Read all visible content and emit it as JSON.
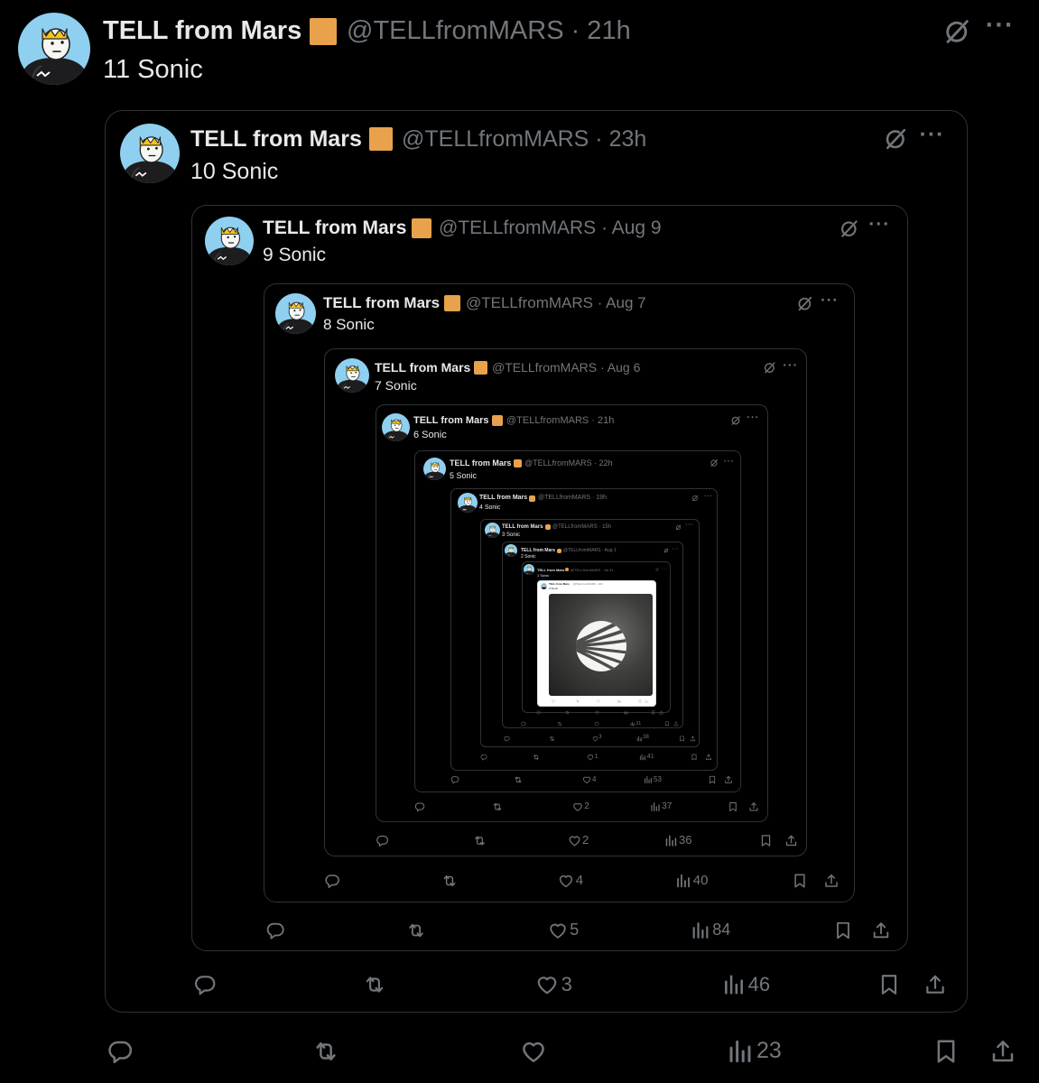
{
  "author_name": "TELL from Mars",
  "author_handle": "@TELLfromMARS",
  "colors": {
    "background": "#000000",
    "text": "#e7e9ea",
    "muted": "#71767b",
    "border": "#2f3336",
    "badge": "#e8a24c",
    "avatar_bg": "#8fd0f0"
  },
  "icons": [
    "avatar-icon",
    "badge-icon",
    "grok-icon",
    "more-icon",
    "reply-icon",
    "retweet-icon",
    "like-icon",
    "views-icon",
    "bookmark-icon",
    "share-icon"
  ],
  "posts": [
    {
      "time": "· 21h",
      "text": "11 Sonic",
      "likes": "",
      "views": "23"
    },
    {
      "time": "· 23h",
      "text": "10 Sonic",
      "likes": "3",
      "views": "46"
    },
    {
      "time": "· Aug 9",
      "text": "9 Sonic",
      "likes": "5",
      "views": "84"
    },
    {
      "time": "· Aug 7",
      "text": "8 Sonic",
      "likes": "4",
      "views": "40"
    },
    {
      "time": "· Aug 6",
      "text": "7 Sonic",
      "likes": "2",
      "views": "36"
    },
    {
      "time": "· 21h",
      "text": "6 Sonic",
      "likes": "2",
      "views": "37"
    },
    {
      "time": "· 22h",
      "text": "5 Sonic",
      "likes": "4",
      "views": "53"
    },
    {
      "time": "· 19h",
      "text": "4 Sonic",
      "likes": "1",
      "views": "41"
    },
    {
      "time": "· 15h",
      "text": "3 Sonic",
      "likes": "3",
      "views": "38"
    },
    {
      "time": "· Aug 1",
      "text": "2 Sonic",
      "likes": "",
      "views": "31"
    },
    {
      "time": "· Jul 31",
      "text": "1 Sonic",
      "likes": "",
      "views": ""
    }
  ],
  "innermost": {
    "name": "TELL from Mars",
    "handle": "@TELLfromMARS",
    "time": "· 10h",
    "text": "0 Sonic"
  }
}
